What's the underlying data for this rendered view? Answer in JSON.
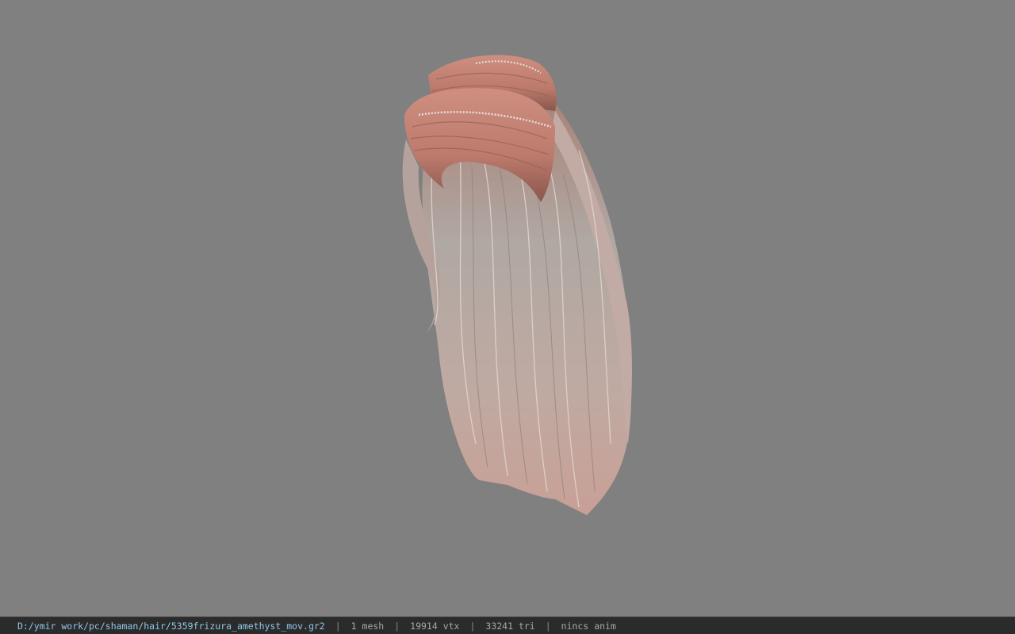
{
  "viewport": {
    "background_color": "#808080",
    "model": {
      "asset_name": "5359frizura_amethyst_mov",
      "hair_color_top": "#c2897a",
      "hair_color_mid": "#b6aca6",
      "hair_color_tips": "#c49a90"
    }
  },
  "status_bar": {
    "file_path": "D:/ymir work/pc/shaman/hair/5359frizura_amethyst_mov.gr2",
    "separator": "|",
    "mesh_count": "1 mesh",
    "vertex_count": "19914 vtx",
    "triangle_count": "33241 tri",
    "anim_status": "nincs anim",
    "path_color": "#8fc7e8",
    "background_color": "#2b2b2b"
  }
}
